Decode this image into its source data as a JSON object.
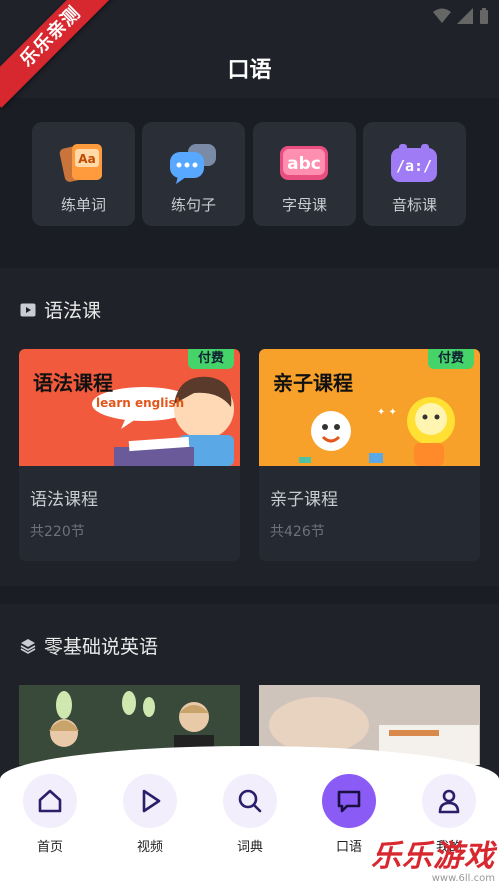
{
  "ribbon": {
    "text": "乐乐亲测"
  },
  "header": {
    "title": "口语"
  },
  "quick_actions": [
    {
      "label": "练单词",
      "icon": "word-card-icon"
    },
    {
      "label": "练句子",
      "icon": "chat-bubbles-icon"
    },
    {
      "label": "字母课",
      "icon": "abc-icon"
    },
    {
      "label": "音标课",
      "icon": "phonetic-icon"
    }
  ],
  "grammar_section": {
    "title": "语法课",
    "cards": [
      {
        "thumb_text": "语法课程",
        "speech": "learn english",
        "badge": "付费",
        "title": "语法课程",
        "count": "共220节"
      },
      {
        "thumb_text": "亲子课程",
        "badge": "付费",
        "title": "亲子课程",
        "count": "共426节"
      }
    ]
  },
  "basic_section": {
    "title": "零基础说英语"
  },
  "bottom_nav": [
    {
      "label": "首页",
      "icon": "home-icon"
    },
    {
      "label": "视频",
      "icon": "play-icon"
    },
    {
      "label": "词典",
      "icon": "search-icon"
    },
    {
      "label": "口语",
      "icon": "speech-bubble-icon",
      "active": true
    },
    {
      "label": "我的",
      "icon": "user-icon"
    }
  ],
  "watermark": {
    "main": "乐乐游戏",
    "sub": "www.6ll.com"
  },
  "colors": {
    "accent": "#8a5cf5",
    "badge": "#45d36a",
    "ribbon": "#d8282f"
  }
}
